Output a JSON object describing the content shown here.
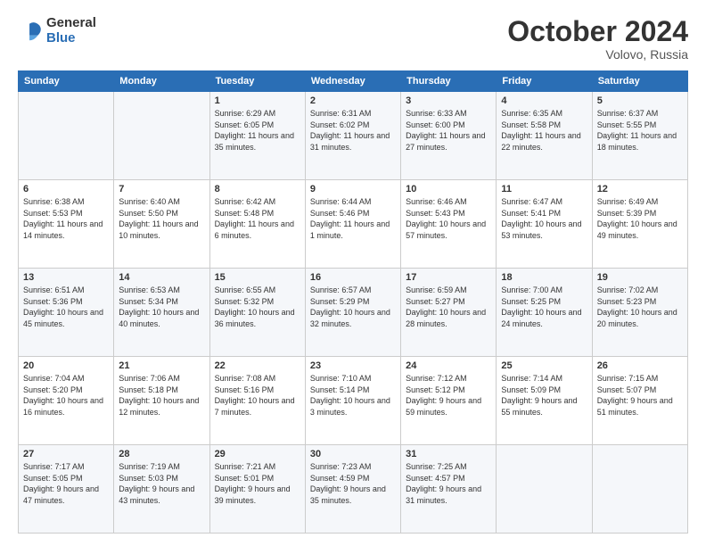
{
  "logo": {
    "general": "General",
    "blue": "Blue"
  },
  "header": {
    "month": "October 2024",
    "location": "Volovo, Russia"
  },
  "weekdays": [
    "Sunday",
    "Monday",
    "Tuesday",
    "Wednesday",
    "Thursday",
    "Friday",
    "Saturday"
  ],
  "rows": [
    [
      {
        "day": "",
        "content": ""
      },
      {
        "day": "",
        "content": ""
      },
      {
        "day": "1",
        "content": "Sunrise: 6:29 AM\nSunset: 6:05 PM\nDaylight: 11 hours and 35 minutes."
      },
      {
        "day": "2",
        "content": "Sunrise: 6:31 AM\nSunset: 6:02 PM\nDaylight: 11 hours and 31 minutes."
      },
      {
        "day": "3",
        "content": "Sunrise: 6:33 AM\nSunset: 6:00 PM\nDaylight: 11 hours and 27 minutes."
      },
      {
        "day": "4",
        "content": "Sunrise: 6:35 AM\nSunset: 5:58 PM\nDaylight: 11 hours and 22 minutes."
      },
      {
        "day": "5",
        "content": "Sunrise: 6:37 AM\nSunset: 5:55 PM\nDaylight: 11 hours and 18 minutes."
      }
    ],
    [
      {
        "day": "6",
        "content": "Sunrise: 6:38 AM\nSunset: 5:53 PM\nDaylight: 11 hours and 14 minutes."
      },
      {
        "day": "7",
        "content": "Sunrise: 6:40 AM\nSunset: 5:50 PM\nDaylight: 11 hours and 10 minutes."
      },
      {
        "day": "8",
        "content": "Sunrise: 6:42 AM\nSunset: 5:48 PM\nDaylight: 11 hours and 6 minutes."
      },
      {
        "day": "9",
        "content": "Sunrise: 6:44 AM\nSunset: 5:46 PM\nDaylight: 11 hours and 1 minute."
      },
      {
        "day": "10",
        "content": "Sunrise: 6:46 AM\nSunset: 5:43 PM\nDaylight: 10 hours and 57 minutes."
      },
      {
        "day": "11",
        "content": "Sunrise: 6:47 AM\nSunset: 5:41 PM\nDaylight: 10 hours and 53 minutes."
      },
      {
        "day": "12",
        "content": "Sunrise: 6:49 AM\nSunset: 5:39 PM\nDaylight: 10 hours and 49 minutes."
      }
    ],
    [
      {
        "day": "13",
        "content": "Sunrise: 6:51 AM\nSunset: 5:36 PM\nDaylight: 10 hours and 45 minutes."
      },
      {
        "day": "14",
        "content": "Sunrise: 6:53 AM\nSunset: 5:34 PM\nDaylight: 10 hours and 40 minutes."
      },
      {
        "day": "15",
        "content": "Sunrise: 6:55 AM\nSunset: 5:32 PM\nDaylight: 10 hours and 36 minutes."
      },
      {
        "day": "16",
        "content": "Sunrise: 6:57 AM\nSunset: 5:29 PM\nDaylight: 10 hours and 32 minutes."
      },
      {
        "day": "17",
        "content": "Sunrise: 6:59 AM\nSunset: 5:27 PM\nDaylight: 10 hours and 28 minutes."
      },
      {
        "day": "18",
        "content": "Sunrise: 7:00 AM\nSunset: 5:25 PM\nDaylight: 10 hours and 24 minutes."
      },
      {
        "day": "19",
        "content": "Sunrise: 7:02 AM\nSunset: 5:23 PM\nDaylight: 10 hours and 20 minutes."
      }
    ],
    [
      {
        "day": "20",
        "content": "Sunrise: 7:04 AM\nSunset: 5:20 PM\nDaylight: 10 hours and 16 minutes."
      },
      {
        "day": "21",
        "content": "Sunrise: 7:06 AM\nSunset: 5:18 PM\nDaylight: 10 hours and 12 minutes."
      },
      {
        "day": "22",
        "content": "Sunrise: 7:08 AM\nSunset: 5:16 PM\nDaylight: 10 hours and 7 minutes."
      },
      {
        "day": "23",
        "content": "Sunrise: 7:10 AM\nSunset: 5:14 PM\nDaylight: 10 hours and 3 minutes."
      },
      {
        "day": "24",
        "content": "Sunrise: 7:12 AM\nSunset: 5:12 PM\nDaylight: 9 hours and 59 minutes."
      },
      {
        "day": "25",
        "content": "Sunrise: 7:14 AM\nSunset: 5:09 PM\nDaylight: 9 hours and 55 minutes."
      },
      {
        "day": "26",
        "content": "Sunrise: 7:15 AM\nSunset: 5:07 PM\nDaylight: 9 hours and 51 minutes."
      }
    ],
    [
      {
        "day": "27",
        "content": "Sunrise: 7:17 AM\nSunset: 5:05 PM\nDaylight: 9 hours and 47 minutes."
      },
      {
        "day": "28",
        "content": "Sunrise: 7:19 AM\nSunset: 5:03 PM\nDaylight: 9 hours and 43 minutes."
      },
      {
        "day": "29",
        "content": "Sunrise: 7:21 AM\nSunset: 5:01 PM\nDaylight: 9 hours and 39 minutes."
      },
      {
        "day": "30",
        "content": "Sunrise: 7:23 AM\nSunset: 4:59 PM\nDaylight: 9 hours and 35 minutes."
      },
      {
        "day": "31",
        "content": "Sunrise: 7:25 AM\nSunset: 4:57 PM\nDaylight: 9 hours and 31 minutes."
      },
      {
        "day": "",
        "content": ""
      },
      {
        "day": "",
        "content": ""
      }
    ]
  ]
}
